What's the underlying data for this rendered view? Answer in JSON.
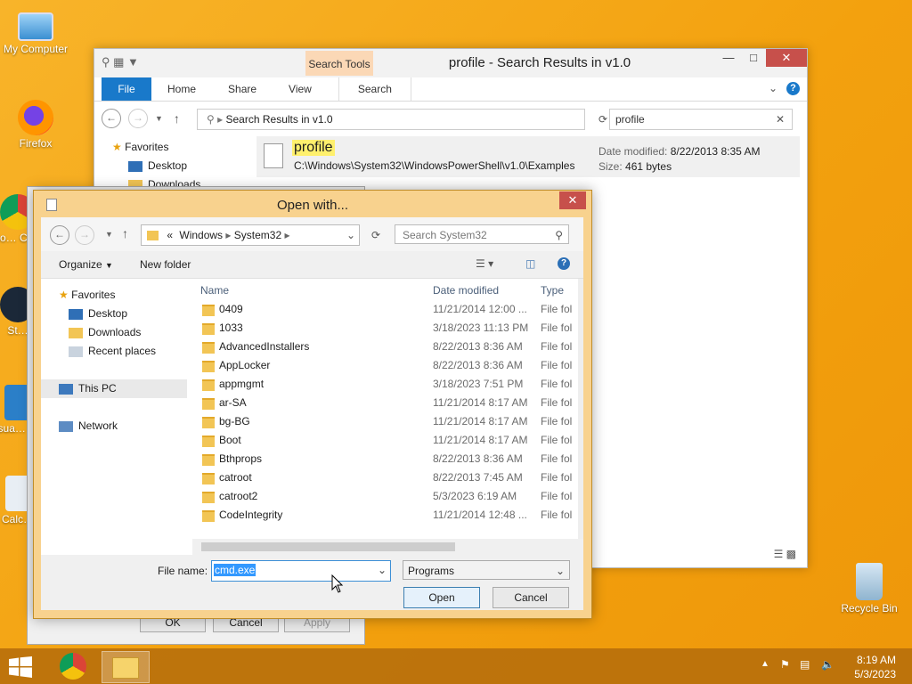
{
  "desktop": {
    "icons": [
      {
        "label": "My Computer"
      },
      {
        "label": "Firefox"
      },
      {
        "label": "Go… Ch…"
      },
      {
        "label": "St…"
      },
      {
        "label": "Visua… C…"
      },
      {
        "label": "Calc…"
      },
      {
        "label": "Recycle Bin"
      }
    ]
  },
  "explorer": {
    "title": "profile - Search Results in v1.0",
    "context_tab": "Search Tools",
    "ribbon_tabs": [
      "File",
      "Home",
      "Share",
      "View",
      "Search"
    ],
    "address": "Search Results in v1.0",
    "search_value": "profile",
    "favorites_label": "Favorites",
    "nav_items": [
      "Desktop",
      "Downloads"
    ],
    "result": {
      "name": "profile",
      "path": "C:\\Windows\\System32\\WindowsPowerShell\\v1.0\\Examples",
      "modified_label": "Date modified:",
      "modified_value": "8/22/2013 8:35 AM",
      "size_label": "Size:",
      "size_value": "461 bytes"
    }
  },
  "properties_dialog": {
    "ok": "OK",
    "cancel": "Cancel",
    "apply": "Apply"
  },
  "open_with": {
    "title": "Open with...",
    "breadcrumb": [
      "«",
      "Windows",
      "System32"
    ],
    "search_placeholder": "Search System32",
    "organize": "Organize",
    "new_folder": "New folder",
    "nav": {
      "favorites": "Favorites",
      "desktop": "Desktop",
      "downloads": "Downloads",
      "recent": "Recent places",
      "this_pc": "This PC",
      "network": "Network"
    },
    "columns": {
      "name": "Name",
      "date": "Date modified",
      "type": "Type"
    },
    "files": [
      {
        "name": "0409",
        "date": "11/21/2014 12:00 ...",
        "type": "File fol"
      },
      {
        "name": "1033",
        "date": "3/18/2023 11:13 PM",
        "type": "File fol"
      },
      {
        "name": "AdvancedInstallers",
        "date": "8/22/2013 8:36 AM",
        "type": "File fol"
      },
      {
        "name": "AppLocker",
        "date": "8/22/2013 8:36 AM",
        "type": "File fol"
      },
      {
        "name": "appmgmt",
        "date": "3/18/2023 7:51 PM",
        "type": "File fol"
      },
      {
        "name": "ar-SA",
        "date": "11/21/2014 8:17 AM",
        "type": "File fol"
      },
      {
        "name": "bg-BG",
        "date": "11/21/2014 8:17 AM",
        "type": "File fol"
      },
      {
        "name": "Boot",
        "date": "11/21/2014 8:17 AM",
        "type": "File fol"
      },
      {
        "name": "Bthprops",
        "date": "8/22/2013 8:36 AM",
        "type": "File fol"
      },
      {
        "name": "catroot",
        "date": "8/22/2013 7:45 AM",
        "type": "File fol"
      },
      {
        "name": "catroot2",
        "date": "5/3/2023 6:19 AM",
        "type": "File fol"
      },
      {
        "name": "CodeIntegrity",
        "date": "11/21/2014 12:48 ...",
        "type": "File fol"
      }
    ],
    "file_name_label": "File name:",
    "file_name_value": "cmd.exe",
    "file_type": "Programs",
    "open_button": "Open",
    "cancel_button": "Cancel"
  },
  "taskbar": {
    "time": "8:19 AM",
    "date": "5/3/2023"
  },
  "colors": {
    "desktop": "#f6a81c",
    "dialog_frame": "#f8d28e",
    "close_red": "#c7504b",
    "file_tab_blue": "#1979ca"
  }
}
